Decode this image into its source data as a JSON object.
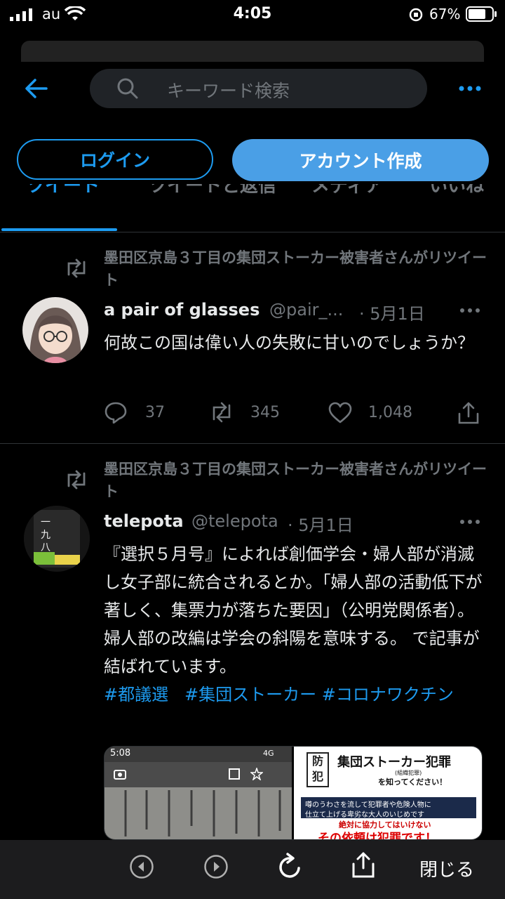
{
  "status_bar": {
    "carrier": "au",
    "time": "4:05",
    "battery": "67%"
  },
  "search": {
    "placeholder": "キーワード検索"
  },
  "auth": {
    "login_label": "ログイン",
    "create_account_label": "アカウント作成"
  },
  "tabs": [
    "ツイート",
    "ツイートと返信",
    "メディア",
    "いいね"
  ],
  "tweets": [
    {
      "retweeted_by": "墨田区京島３丁目の集団ストーカー被害者さんがリツイート",
      "name": "a pair of glasses",
      "handle": "@pair_...",
      "date": "· 5月1日",
      "text": "何故この国は偉い人の失敗に甘いのでしょうか？",
      "replies": "37",
      "retweets": "345",
      "likes": "1,048"
    },
    {
      "retweeted_by": "墨田区京島３丁目の集団ストーカー被害者さんがリツイート",
      "name": "telepota",
      "handle": "@telepota",
      "date": "· 5月1日",
      "text": "『選択５月号』によれば創価学会・婦人部が消滅し女子部に統合されるとか。「婦人部の活動低下が著しく、集票力が落ちた要因」（公明党関係者）。婦人部の改編は学会の斜陽を意味する。 で記事が結ばれています。",
      "hashtags": [
        "#都議選",
        "#集団ストーカー",
        "#コロナワクチン"
      ],
      "media": {
        "left_time": "5:08",
        "left_signal": "4G",
        "right_stamp": "防犯",
        "right_title": "集団ストーカー犯罪",
        "right_sub": "(組織犯罪)",
        "right_know": "を知ってください！",
        "right_line1": "噂のうわさを流して犯罪者や危険人物に",
        "right_line2": "仕立て上げる卑劣な大人のいじめです",
        "right_warn": "絶対に協力してはいけない",
        "right_big": "その依頼は犯罪です！"
      }
    }
  ],
  "bottom_bar": {
    "close_label": "閉じる"
  },
  "colors": {
    "accent": "#1d9bf0",
    "background": "#000000",
    "muted": "#71767b"
  }
}
